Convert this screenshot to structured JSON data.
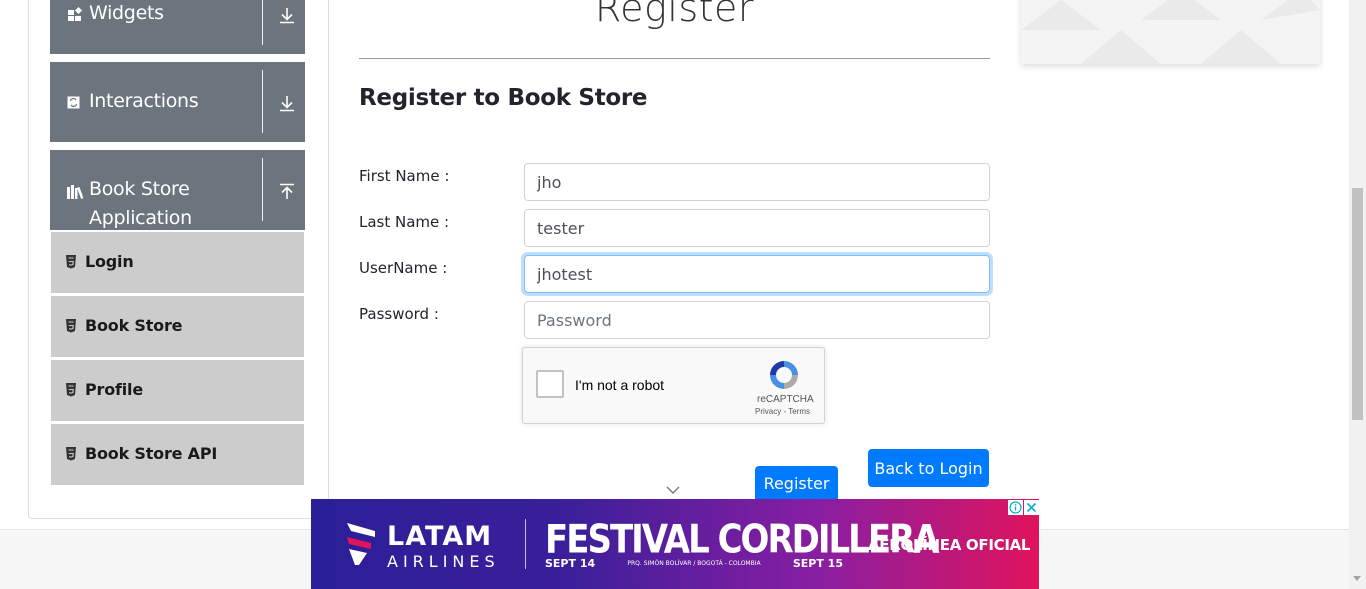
{
  "sidebar": {
    "groups": [
      {
        "label": "Widgets",
        "icon": "widgets-icon",
        "expanded": false
      },
      {
        "label": "Interactions",
        "icon": "interactions-icon",
        "expanded": false
      },
      {
        "label_line1": "Book Store",
        "label_line2": "Application",
        "icon": "books-icon",
        "expanded": true
      }
    ],
    "items": [
      {
        "label": "Login",
        "icon": "html5-icon"
      },
      {
        "label": "Book Store",
        "icon": "html5-icon"
      },
      {
        "label": "Profile",
        "icon": "html5-icon"
      },
      {
        "label": "Book Store API",
        "icon": "html5-icon"
      }
    ]
  },
  "main": {
    "page_title": "Register",
    "form_title": "Register to Book Store",
    "fields": {
      "first_name": {
        "label": "First Name :",
        "value": "jho"
      },
      "last_name": {
        "label": "Last Name :",
        "value": "tester"
      },
      "username": {
        "label": "UserName :",
        "value": "jhotest"
      },
      "password": {
        "label": "Password :",
        "value": "",
        "placeholder": "Password"
      }
    },
    "captcha": {
      "label": "I'm not a robot",
      "brand": "reCAPTCHA",
      "privacy": "Privacy",
      "terms": "Terms"
    },
    "buttons": {
      "register": "Register",
      "back_to_login": "Back to Login"
    }
  },
  "ad": {
    "brand": "LATAM",
    "brand_sub": "AIRLINES",
    "headline": "FESTIVAL CORDILLERA",
    "date_start": "SEPT 14",
    "venue": "PRQ. SIMÓN BOLÍVAR / BOGOTÁ - COLOMBIA",
    "date_end": "SEPT 15",
    "tagline": "AEROLÍNEA OFICIAL"
  },
  "colors": {
    "sidebar_group": "#6c757d",
    "sidebar_item": "#cccccc",
    "primary": "#007bff",
    "focus_border": "#80bdff"
  }
}
